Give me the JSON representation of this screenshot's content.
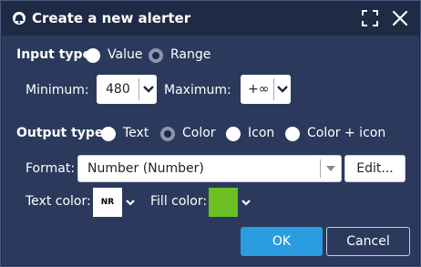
{
  "dialog": {
    "title": "Create a new alerter"
  },
  "input_type": {
    "label": "Input type:",
    "options": [
      {
        "label": "Value",
        "selected": false
      },
      {
        "label": "Range",
        "selected": true
      }
    ]
  },
  "range": {
    "min_label": "Minimum:",
    "min_value": "480",
    "max_label": "Maximum:",
    "max_value": "+∞"
  },
  "output_type": {
    "label": "Output type:",
    "options": [
      {
        "label": "Text",
        "selected": false
      },
      {
        "label": "Color",
        "selected": true
      },
      {
        "label": "Icon",
        "selected": false
      },
      {
        "label": "Color + icon",
        "selected": false
      }
    ]
  },
  "format": {
    "label": "Format:",
    "value": "Number (Number)",
    "edit_label": "Edit..."
  },
  "colors": {
    "text_color_label": "Text color:",
    "text_color_preview": "NR",
    "text_color_hex": "#ffffff",
    "fill_color_label": "Fill color:",
    "fill_color_hex": "#6cc024"
  },
  "actions": {
    "ok_label": "OK",
    "cancel_label": "Cancel"
  },
  "theme": {
    "title_bg": "#1f2a44",
    "body_bg": "#2b395c",
    "accent": "#2a9ce0"
  }
}
